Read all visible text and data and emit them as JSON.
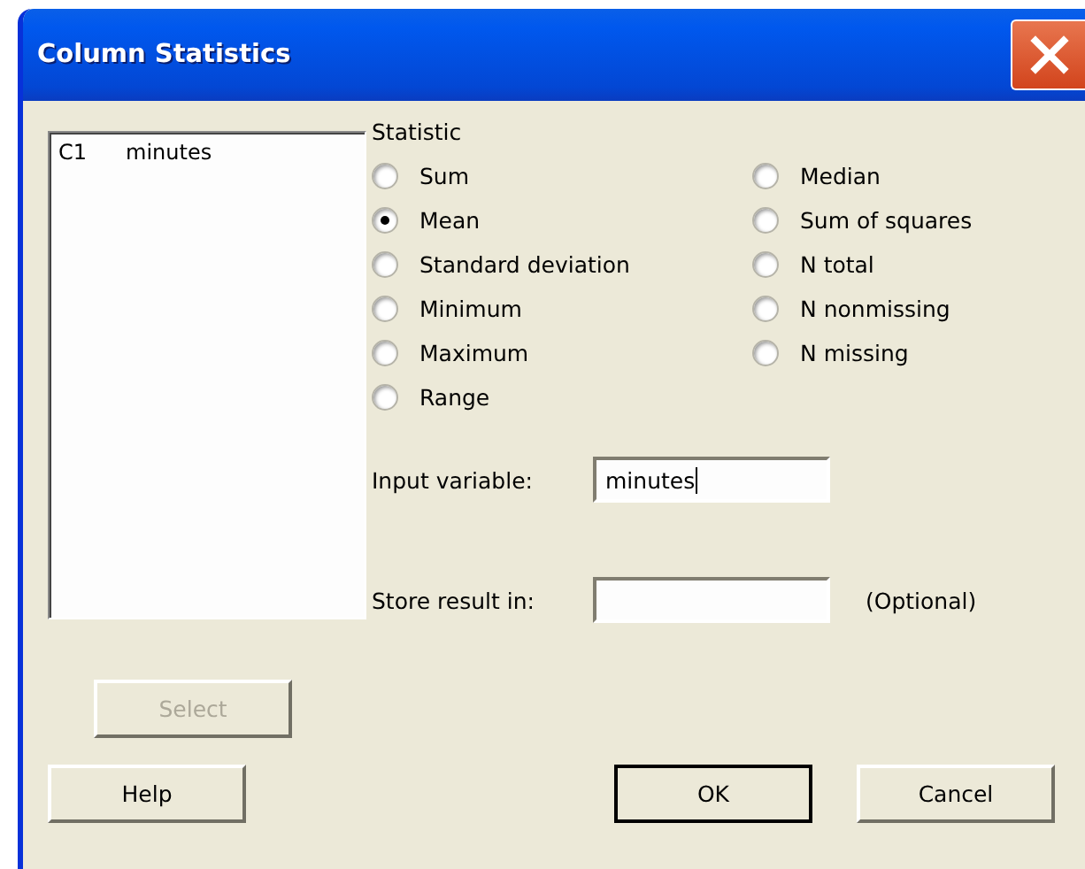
{
  "window": {
    "title": "Column Statistics"
  },
  "variables": [
    {
      "column": "C1",
      "name": "minutes",
      "selected": false
    }
  ],
  "statistic": {
    "label": "Statistic",
    "columns": [
      [
        {
          "label": "Sum",
          "selected": false
        },
        {
          "label": "Mean",
          "selected": true
        },
        {
          "label": "Standard deviation",
          "selected": false
        },
        {
          "label": "Minimum",
          "selected": false
        },
        {
          "label": "Maximum",
          "selected": false
        },
        {
          "label": "Range",
          "selected": false
        }
      ],
      [
        {
          "label": "Median",
          "selected": false
        },
        {
          "label": "Sum of squares",
          "selected": false
        },
        {
          "label": "N total",
          "selected": false
        },
        {
          "label": "N nonmissing",
          "selected": false
        },
        {
          "label": "N missing",
          "selected": false
        }
      ]
    ]
  },
  "input_variable": {
    "label": "Input variable:",
    "value": "minutes"
  },
  "store_result": {
    "label": "Store result in:",
    "note": "(Optional)"
  },
  "select_button": {
    "label": "Select",
    "disabled": true
  },
  "buttons": [
    {
      "label": "Help",
      "default": false
    },
    {
      "label": "OK",
      "default": true
    },
    {
      "label": "Cancel",
      "default": false
    }
  ]
}
